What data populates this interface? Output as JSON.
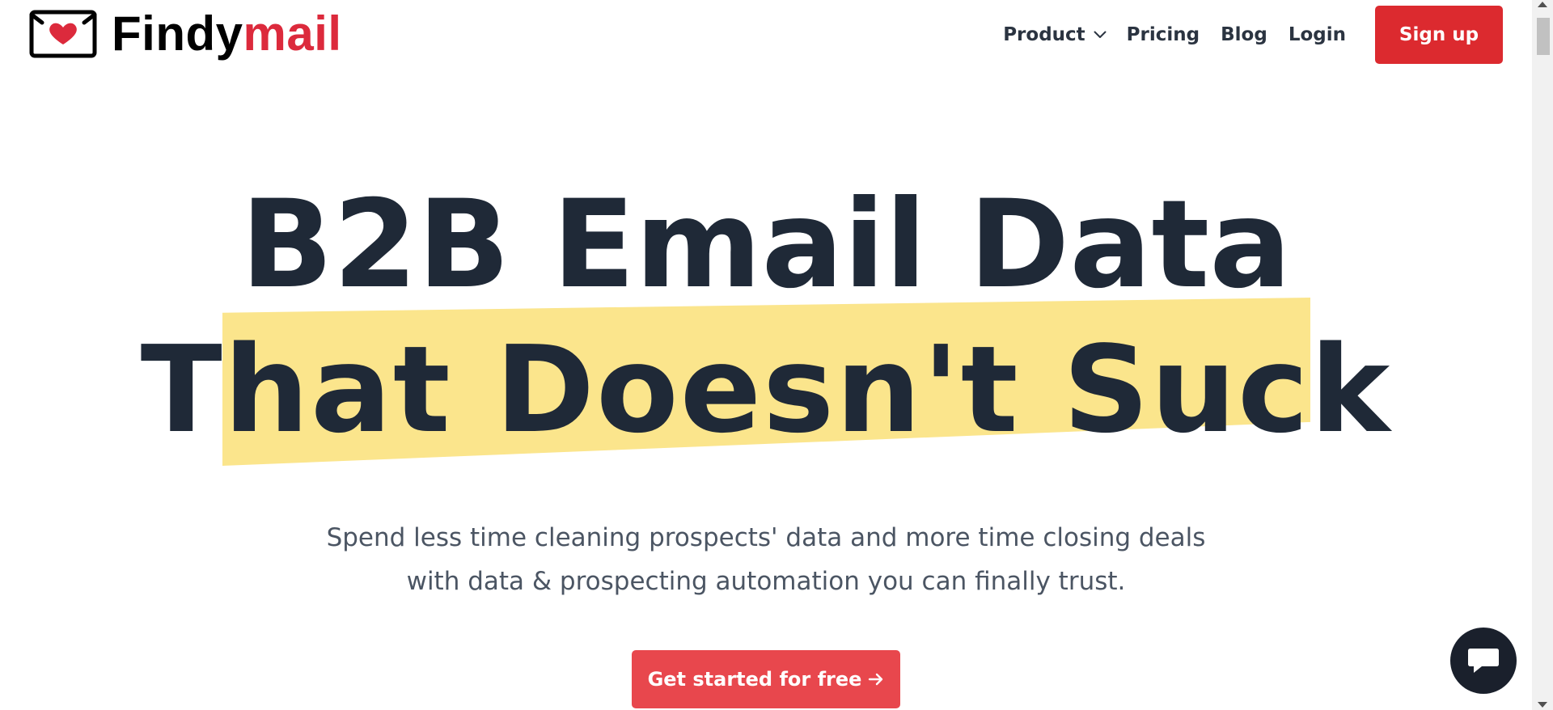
{
  "header": {
    "logo": {
      "text_part1": "Findy",
      "text_part2": "mail",
      "icon": "envelope-heart-icon"
    },
    "nav": {
      "product_label": "Product",
      "pricing_label": "Pricing",
      "blog_label": "Blog",
      "login_label": "Login",
      "signup_label": "Sign up"
    }
  },
  "hero": {
    "headline_line1": "B2B Email Data",
    "headline_line2": "That Doesn't Suck",
    "subtitle_line1": "Spend less time cleaning prospects' data and more time closing deals",
    "subtitle_line2": "with data & prospecting automation you can finally trust.",
    "cta_label": "Get started for free"
  },
  "chat_widget": {
    "icon": "chat-bubble-icon"
  },
  "colors": {
    "brand_red": "#dc2a3c",
    "button_red": "#dc2a2f",
    "cta_red": "#e8474d",
    "highlight_yellow": "#fbe58c",
    "heading_dark": "#1f2937",
    "body_gray": "#4b5563",
    "chat_dark": "#1a202c"
  }
}
